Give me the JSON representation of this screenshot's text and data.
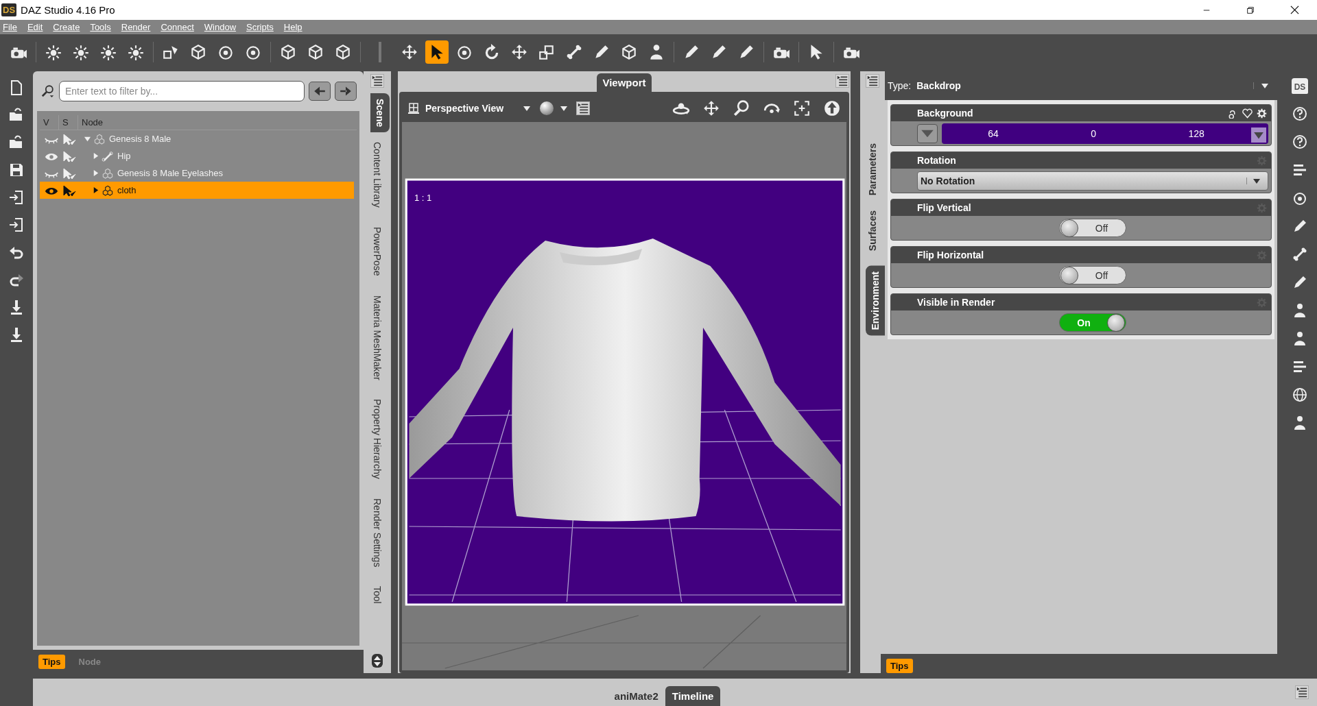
{
  "window": {
    "logo": "DS",
    "title": "DAZ Studio 4.16 Pro"
  },
  "menu": [
    "File",
    "Edit",
    "Create",
    "Tools",
    "Render",
    "Connect",
    "Window",
    "Scripts",
    "Help"
  ],
  "toolbar": [
    {
      "kind": "camera",
      "selected": false
    },
    {
      "kind": "light",
      "selected": false
    },
    {
      "kind": "light",
      "selected": false
    },
    {
      "kind": "light",
      "selected": false
    },
    {
      "kind": "light",
      "selected": false
    },
    {
      "kind": "shapes",
      "selected": false
    },
    {
      "kind": "cube",
      "selected": false
    },
    {
      "kind": "ring",
      "selected": false
    },
    {
      "kind": "ring",
      "selected": false
    },
    {
      "kind": "cube",
      "selected": false
    },
    {
      "kind": "cube",
      "selected": false
    },
    {
      "kind": "cube",
      "selected": false
    },
    {
      "kind": "move",
      "selected": false
    },
    {
      "kind": "cursor",
      "selected": true
    },
    {
      "kind": "ring",
      "selected": false
    },
    {
      "kind": "rotate",
      "selected": false
    },
    {
      "kind": "move",
      "selected": false
    },
    {
      "kind": "scale",
      "selected": false
    },
    {
      "kind": "bone",
      "selected": false
    },
    {
      "kind": "pencil",
      "selected": false
    },
    {
      "kind": "cube",
      "selected": false
    },
    {
      "kind": "figure",
      "selected": false
    },
    {
      "kind": "pencil",
      "selected": false
    },
    {
      "kind": "pencil",
      "selected": false
    },
    {
      "kind": "pencil",
      "selected": false
    },
    {
      "kind": "camera",
      "selected": false
    },
    {
      "kind": "cursor",
      "selected": false
    },
    {
      "kind": "camera",
      "selected": false
    }
  ],
  "side_home_label": "DS",
  "scene_panel": {
    "filter": {
      "placeholder": "Enter text to filter by..."
    },
    "columns": [
      "V",
      "S",
      "Node"
    ],
    "nodes": [
      {
        "name": "Genesis 8 Male",
        "kind": "figure",
        "visible": false,
        "expanded": true,
        "selected": false,
        "children": [
          {
            "name": "Hip",
            "kind": "bone",
            "visible": true,
            "expanded": false,
            "selected": false
          },
          {
            "name": "Genesis 8 Male Eyelashes",
            "kind": "figure",
            "visible": false,
            "expanded": false,
            "selected": false
          },
          {
            "name": "cloth",
            "kind": "figure",
            "visible": true,
            "expanded": false,
            "selected": true
          }
        ]
      }
    ],
    "footer": {
      "tips": "Tips",
      "label": "Node"
    }
  },
  "left_tabs": [
    {
      "label": "Scene",
      "selected": true
    },
    {
      "label": "Content Library",
      "selected": false
    },
    {
      "label": "PowerPose",
      "selected": false
    },
    {
      "label": "Materia MeshMaker",
      "selected": false
    },
    {
      "label": "Property Hierarchy",
      "selected": false
    },
    {
      "label": "Render Settings",
      "selected": false
    },
    {
      "label": "Tool",
      "selected": false
    }
  ],
  "viewport": {
    "tab": "Viewport",
    "view": "Perspective View",
    "ratio": "1 : 1"
  },
  "right_tabs": [
    {
      "label": "Parameters",
      "selected": false
    },
    {
      "label": "Surfaces",
      "selected": false
    },
    {
      "label": "Environment",
      "selected": true
    }
  ],
  "environment": {
    "type_label": "Type:",
    "type": "Backdrop",
    "properties": [
      {
        "kind": "color",
        "name": "Background",
        "values": [
          "64",
          "0",
          "128"
        ],
        "color": "#400080"
      },
      {
        "kind": "dropdown",
        "name": "Rotation",
        "value": "No Rotation"
      },
      {
        "kind": "toggle",
        "name": "Flip Vertical",
        "on": false,
        "label": "Off"
      },
      {
        "kind": "toggle",
        "name": "Flip Horizontal",
        "on": false,
        "label": "Off"
      },
      {
        "kind": "toggle",
        "name": "Visible in Render",
        "on": true,
        "label": "On"
      }
    ],
    "tips": "Tips"
  },
  "bottom_tabs": [
    {
      "label": "aniMate2",
      "selected": false
    },
    {
      "label": "Timeline",
      "selected": true
    }
  ]
}
